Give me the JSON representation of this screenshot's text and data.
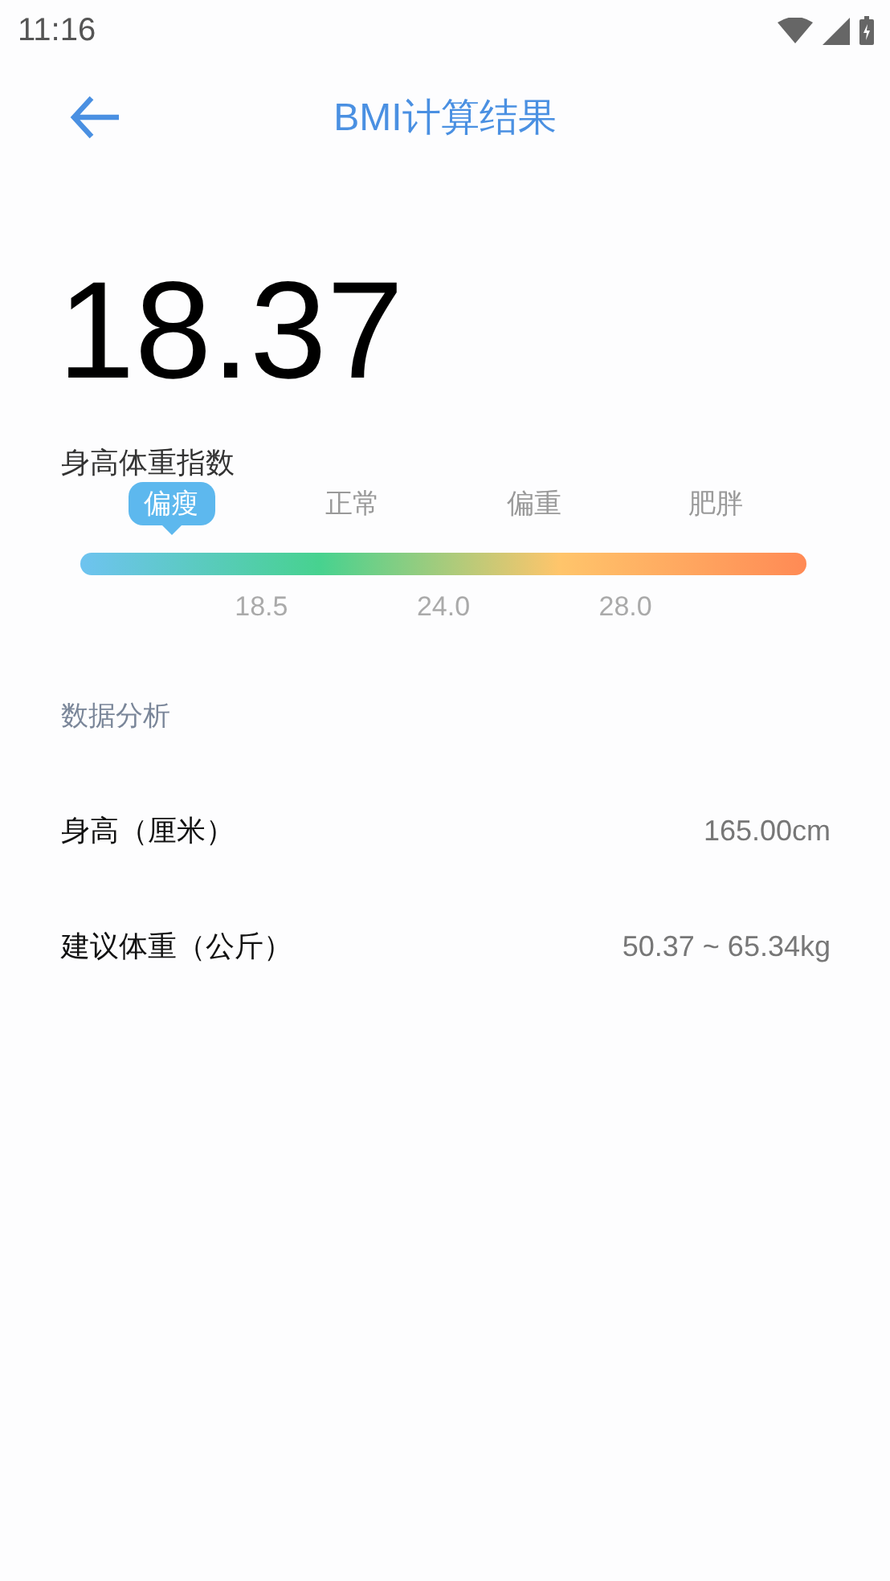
{
  "status_bar": {
    "time": "11:16"
  },
  "header": {
    "title": "BMI计算结果"
  },
  "bmi": {
    "value": "18.37",
    "label": "身高体重指数"
  },
  "scale": {
    "categories": [
      {
        "label": "偏瘦",
        "selected": true
      },
      {
        "label": "正常",
        "selected": false
      },
      {
        "label": "偏重",
        "selected": false
      },
      {
        "label": "肥胖",
        "selected": false
      }
    ],
    "thresholds": [
      "18.5",
      "24.0",
      "28.0"
    ]
  },
  "analysis": {
    "title": "数据分析",
    "rows": [
      {
        "label": "身高（厘米）",
        "value": "165.00cm"
      },
      {
        "label": "建议体重（公斤）",
        "value": "50.37 ~ 65.34kg"
      }
    ]
  }
}
